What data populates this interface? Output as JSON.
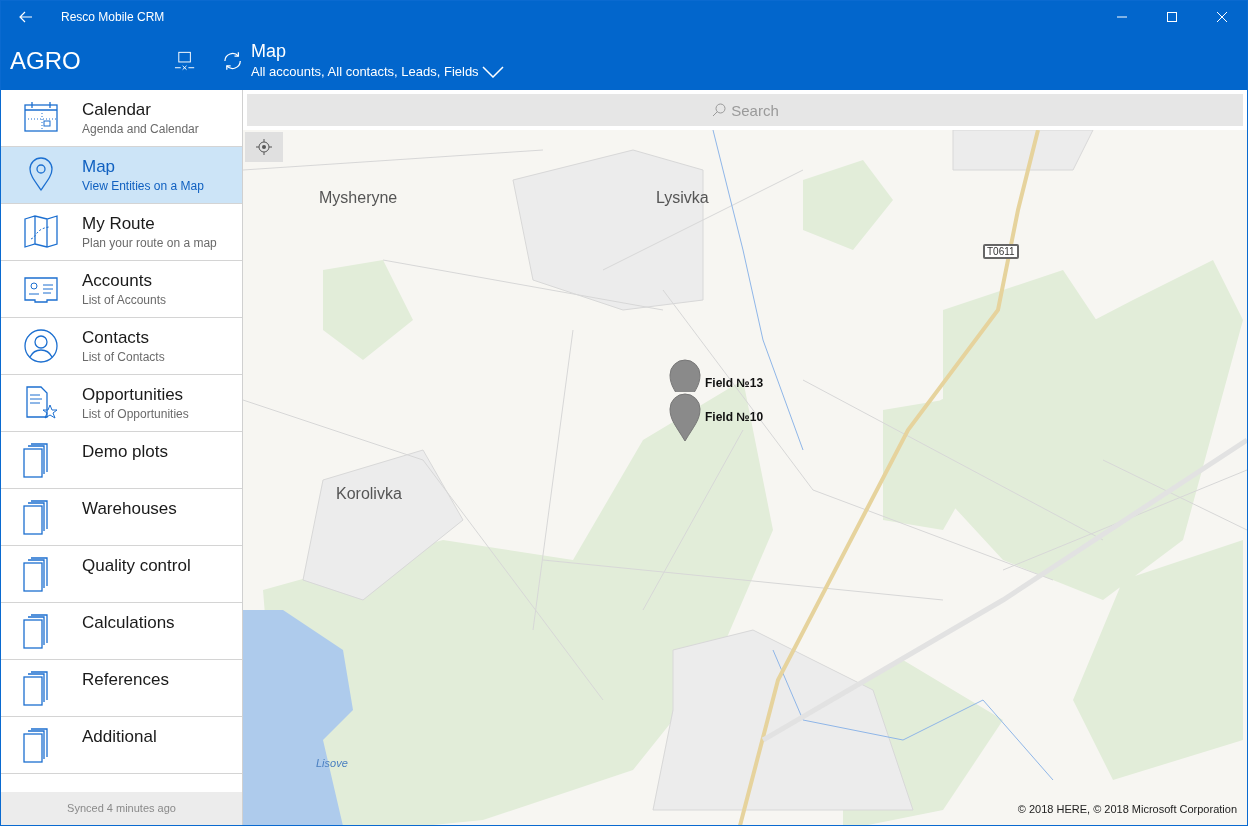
{
  "window": {
    "title": "Resco Mobile CRM"
  },
  "app": {
    "name": "AGRO"
  },
  "header": {
    "title": "Map",
    "subtitle": "All accounts, All contacts, Leads, Fields"
  },
  "sidebar": {
    "items": [
      {
        "kind": "calendar",
        "label": "Calendar",
        "subtitle": "Agenda and Calendar",
        "selected": false
      },
      {
        "kind": "pin",
        "label": "Map",
        "subtitle": "View Entities on a Map",
        "selected": true
      },
      {
        "kind": "route",
        "label": "My Route",
        "subtitle": "Plan your route on a map",
        "selected": false
      },
      {
        "kind": "accounts",
        "label": "Accounts",
        "subtitle": "List of Accounts",
        "selected": false
      },
      {
        "kind": "contacts",
        "label": "Contacts",
        "subtitle": "List of Contacts",
        "selected": false
      },
      {
        "kind": "opportunities",
        "label": "Opportunities",
        "subtitle": "List of Opportunities",
        "selected": false
      },
      {
        "kind": "folder",
        "label": "Demo plots",
        "selected": false
      },
      {
        "kind": "folder",
        "label": "Warehouses",
        "selected": false
      },
      {
        "kind": "folder",
        "label": "Quality control",
        "selected": false
      },
      {
        "kind": "folder",
        "label": "Calculations",
        "selected": false
      },
      {
        "kind": "folder",
        "label": "References",
        "selected": false
      },
      {
        "kind": "folder",
        "label": "Additional",
        "selected": false
      }
    ],
    "status": "Synced 4 minutes ago"
  },
  "search": {
    "placeholder": "Search"
  },
  "map": {
    "places": [
      {
        "kind": "town",
        "label": "Mysheryne"
      },
      {
        "kind": "town",
        "label": "Lysivka"
      },
      {
        "kind": "town",
        "label": "Korolivka"
      },
      {
        "kind": "water",
        "label": "Lisove"
      },
      {
        "kind": "road",
        "label": "T0611"
      }
    ],
    "markers": [
      {
        "label": "Field №13"
      },
      {
        "label": "Field №10"
      }
    ],
    "copyright": "© 2018 HERE, © 2018 Microsoft Corporation"
  }
}
